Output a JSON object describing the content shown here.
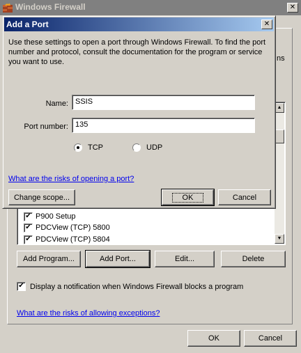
{
  "firewall": {
    "title": "Windows Firewall",
    "partial_text": "ns",
    "list_items": [
      {
        "label": "P900 Setup",
        "checked": true
      },
      {
        "label": "PDCView (TCP) 5800",
        "checked": true
      },
      {
        "label": "PDCView (TCP) 5804",
        "checked": true
      }
    ],
    "buttons": {
      "add_program": "Add Program...",
      "add_port": "Add Port...",
      "edit": "Edit...",
      "delete": "Delete"
    },
    "notify_label": "Display a notification when Windows Firewall blocks a program",
    "notify_checked": true,
    "risks_link": "What are the risks of allowing exceptions?",
    "ok": "OK",
    "cancel": "Cancel"
  },
  "dialog": {
    "title": "Add a Port",
    "close_glyph": "✕",
    "intro": "Use these settings to open a port through Windows Firewall. To find the port number and protocol, consult the documentation for the program or service you want to use.",
    "name_label": "Name:",
    "name_value": "SSIS",
    "port_label": "Port number:",
    "port_value": "135",
    "protocols": [
      {
        "label": "TCP",
        "selected": true
      },
      {
        "label": "UDP",
        "selected": false
      }
    ],
    "risks_link": "What are the risks of opening a port?",
    "change_scope": "Change scope...",
    "ok": "OK",
    "cancel": "Cancel"
  },
  "icons": {
    "app_icon": "firewall-icon",
    "check": "✔"
  }
}
